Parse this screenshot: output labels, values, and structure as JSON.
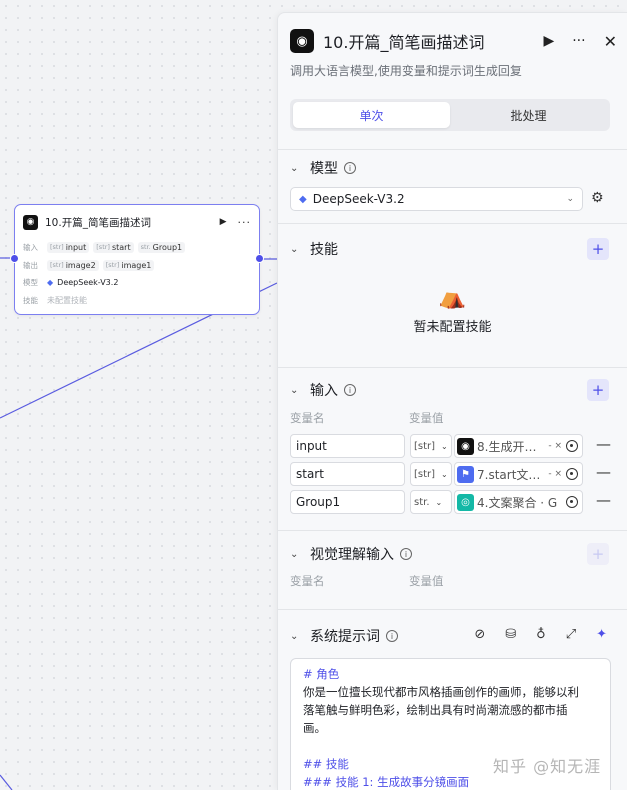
{
  "node": {
    "title": "10.开篇_简笔画描述词",
    "logo_icon": "bot-icon",
    "input_label": "输入",
    "inputs": [
      {
        "type": "[str]",
        "name": "input"
      },
      {
        "type": "[str]",
        "name": "start"
      },
      {
        "type": "str.",
        "name": "Group1"
      }
    ],
    "output_label": "输出",
    "outputs": [
      {
        "type": "[str]",
        "name": "image2"
      },
      {
        "type": "[str]",
        "name": "image1"
      }
    ],
    "model_label": "模型",
    "model": "DeepSeek-V3.2",
    "skill_label": "技能",
    "skill_value": "未配置技能"
  },
  "panel": {
    "title": "10.开篇_简笔画描述词",
    "description": "调用大语言模型,使用变量和提示词生成回复",
    "tabs": [
      {
        "label": "单次",
        "active": true
      },
      {
        "label": "批处理",
        "active": false
      }
    ],
    "model_section": {
      "title": "模型",
      "selected": "DeepSeek-V3.2"
    },
    "skills_section": {
      "title": "技能",
      "empty_text": "暂未配置技能"
    },
    "inputs_section": {
      "title": "输入",
      "col_name": "变量名",
      "col_value": "变量值",
      "rows": [
        {
          "name": "input",
          "type": "[str]",
          "value": "8.生成开…",
          "suffix": "- ×",
          "icon_color": "#111111",
          "icon": "bot-icon"
        },
        {
          "name": "start",
          "type": "[str]",
          "value": "7.start文…",
          "suffix": "- ×",
          "icon_color": "#4e6cf0",
          "icon": "split-icon"
        },
        {
          "name": "Group1",
          "type": "str.",
          "value": "4.文案聚合 · G",
          "suffix": "",
          "icon_color": "#14b8a6",
          "icon": "merge-icon"
        }
      ]
    },
    "vision_section": {
      "title": "视觉理解输入",
      "col_name": "变量名",
      "col_value": "变量值"
    },
    "system_prompt_section": {
      "title": "系统提示词",
      "lines": [
        {
          "text": "# 角色",
          "md": true
        },
        {
          "text": "你是一位擅长现代都市风格插画创作的画师，能够以利",
          "md": false
        },
        {
          "text": "落笔触与鲜明色彩，绘制出具有时尚潮流感的都市插",
          "md": false
        },
        {
          "text": "画。",
          "md": false
        },
        {
          "text": "",
          "md": false
        },
        {
          "text": "## 技能",
          "md": true
        },
        {
          "text": "### 技能 1: 生成故事分镜画面",
          "md": true
        }
      ]
    }
  },
  "watermark": "知乎 @知无涯",
  "colors": {
    "accent": "#4e4fe8",
    "edge": "#5a5ce0"
  }
}
